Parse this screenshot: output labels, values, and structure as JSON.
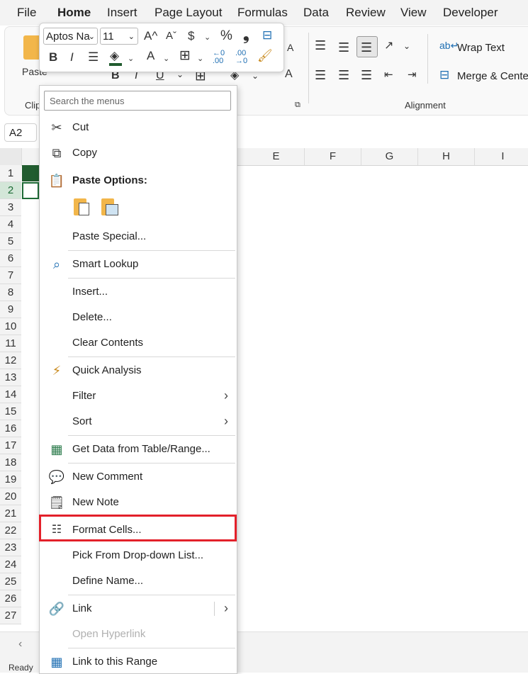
{
  "menubar": {
    "tabs": [
      "File",
      "Home",
      "Insert",
      "Page Layout",
      "Formulas",
      "Data",
      "Review",
      "View",
      "Developer"
    ],
    "active": "Home"
  },
  "ribbon": {
    "paste_label": "Paste",
    "clipboard_label": "Clip",
    "wrap_text": "Wrap Text",
    "merge_center": "Merge & Cente",
    "alignment_label": "Alignment"
  },
  "minibar": {
    "font_name": "Aptos Na",
    "font_size": "11"
  },
  "namebox": {
    "value": "A2"
  },
  "columns": [
    "E",
    "F",
    "G",
    "H",
    "I"
  ],
  "rows": [
    "1",
    "2",
    "3",
    "4",
    "5",
    "6",
    "7",
    "8",
    "9",
    "10",
    "11",
    "12",
    "13",
    "14",
    "15",
    "16",
    "17",
    "18",
    "19",
    "20",
    "21",
    "22",
    "23",
    "24",
    "25",
    "26",
    "27"
  ],
  "status": {
    "ready": "Ready"
  },
  "context_menu": {
    "search_placeholder": "Search the menus",
    "items": {
      "cut": "Cut",
      "copy": "Copy",
      "paste_options": "Paste Options:",
      "paste_special": "Paste Special...",
      "smart_lookup": "Smart Lookup",
      "insert": "Insert...",
      "delete": "Delete...",
      "clear_contents": "Clear Contents",
      "quick_analysis": "Quick Analysis",
      "filter": "Filter",
      "sort": "Sort",
      "get_data": "Get Data from Table/Range...",
      "new_comment": "New Comment",
      "new_note": "New Note",
      "format_cells": "Format Cells...",
      "pick_dropdown": "Pick From Drop-down List...",
      "define_name": "Define Name...",
      "link": "Link",
      "open_hyperlink": "Open Hyperlink",
      "link_to_range": "Link to this Range"
    }
  },
  "colors": {
    "highlight_border": "#e3202a",
    "excel_green": "#215c2f"
  }
}
